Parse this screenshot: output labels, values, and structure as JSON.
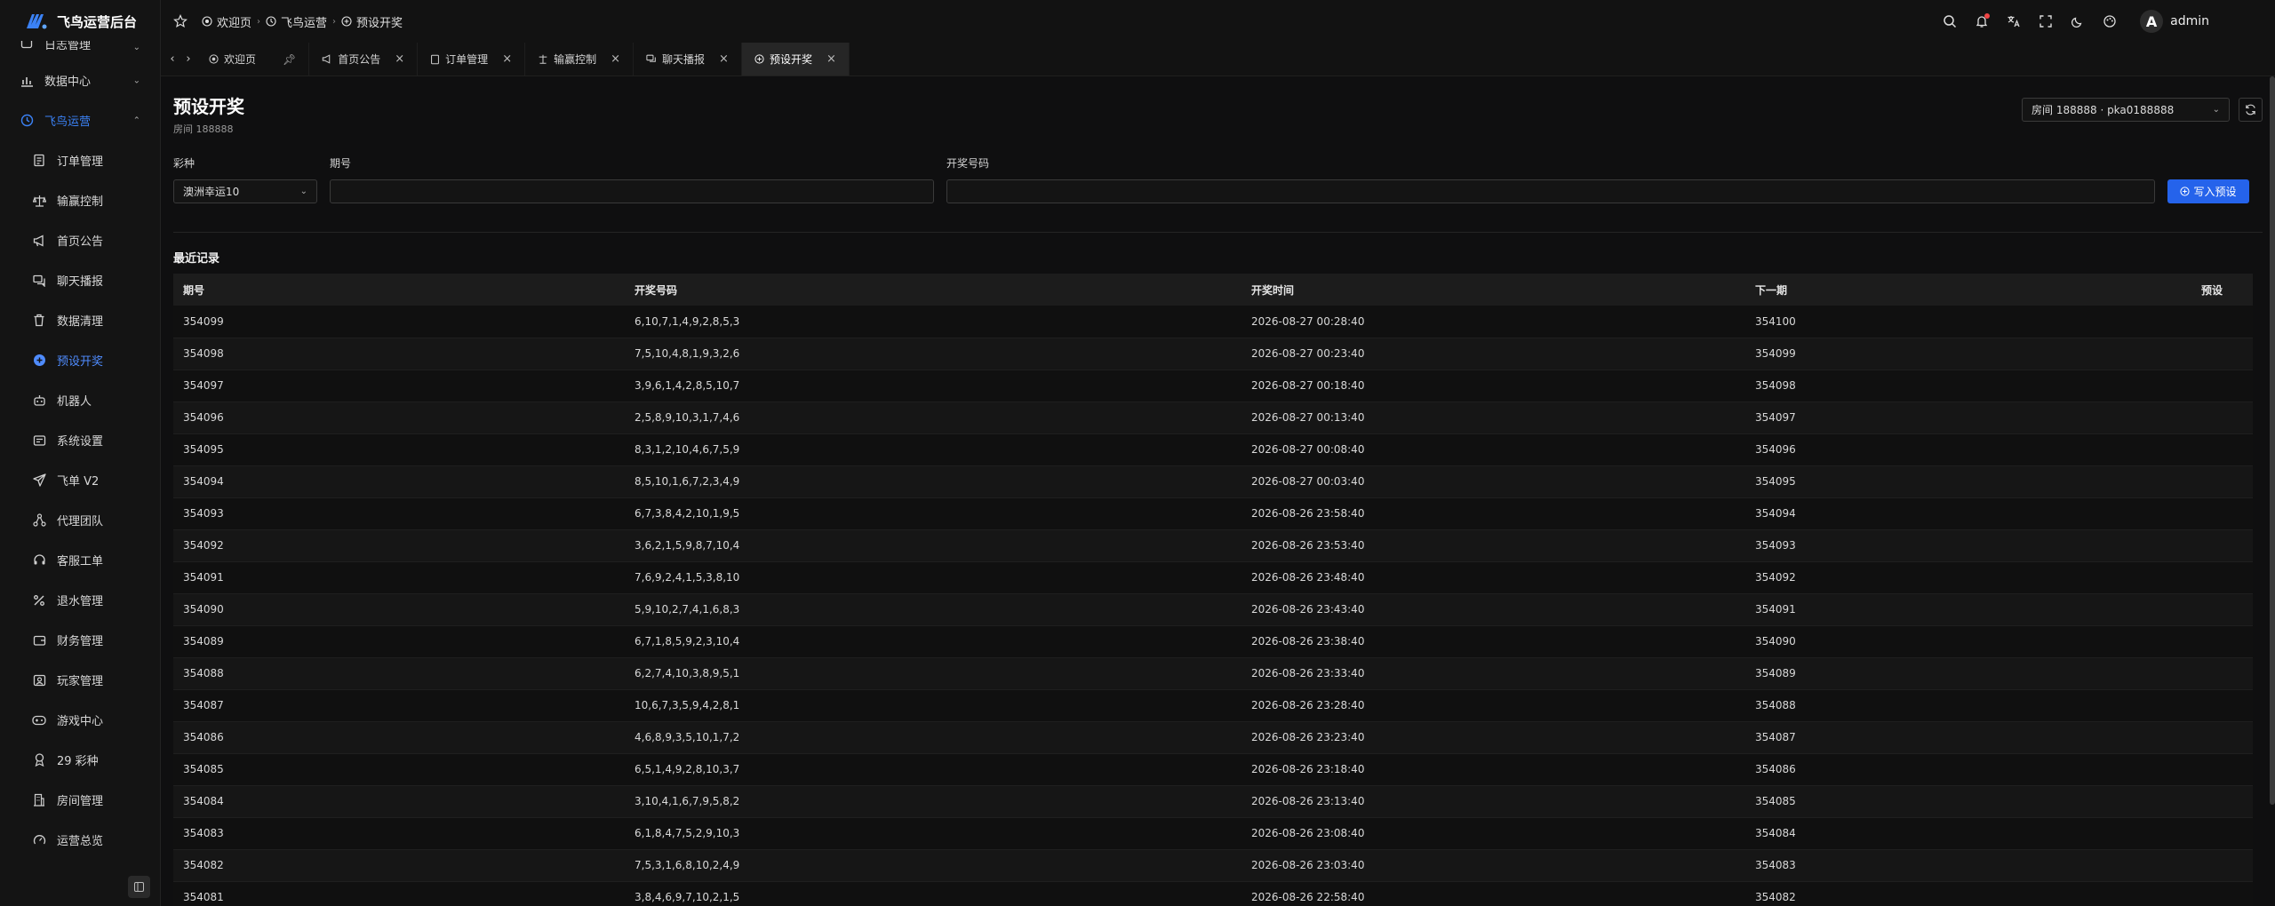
{
  "app": {
    "title": "飞鸟运营后台"
  },
  "sidebar": {
    "items": [
      {
        "label": "日志管理",
        "icon": "log-icon",
        "chev": "⌄"
      },
      {
        "label": "数据中心",
        "icon": "chart-icon",
        "chev": "⌄"
      },
      {
        "label": "飞鸟运营",
        "icon": "clock-icon",
        "chev": "⌃"
      },
      {
        "label": "订单管理",
        "icon": "order-icon"
      },
      {
        "label": "输赢控制",
        "icon": "scale-icon"
      },
      {
        "label": "首页公告",
        "icon": "megaphone-icon"
      },
      {
        "label": "聊天播报",
        "icon": "chat-icon"
      },
      {
        "label": "数据清理",
        "icon": "trash-icon"
      },
      {
        "label": "预设开奖",
        "icon": "plus-circle-icon"
      },
      {
        "label": "机器人",
        "icon": "robot-icon"
      },
      {
        "label": "系统设置",
        "icon": "settings-icon"
      },
      {
        "label": "飞单 V2",
        "icon": "plane-icon"
      },
      {
        "label": "代理团队",
        "icon": "team-icon"
      },
      {
        "label": "客服工单",
        "icon": "headset-icon"
      },
      {
        "label": "退水管理",
        "icon": "percent-icon"
      },
      {
        "label": "财务管理",
        "icon": "wallet-icon"
      },
      {
        "label": "玩家管理",
        "icon": "users-icon"
      },
      {
        "label": "游戏中心",
        "icon": "gamepad-icon"
      },
      {
        "label": "29 彩种",
        "icon": "lottery-icon"
      },
      {
        "label": "房间管理",
        "icon": "building-icon"
      },
      {
        "label": "运营总览",
        "icon": "gauge-icon"
      }
    ]
  },
  "header": {
    "breadcrumb": [
      "欢迎页",
      "飞鸟运营",
      "预设开奖"
    ],
    "user": "admin",
    "avatar_letter": "A"
  },
  "tabs": [
    {
      "label": "欢迎页",
      "closable": false
    },
    {
      "label": "首页公告",
      "closable": true
    },
    {
      "label": "订单管理",
      "closable": true
    },
    {
      "label": "输赢控制",
      "closable": true
    },
    {
      "label": "聊天播报",
      "closable": true
    },
    {
      "label": "预设开奖",
      "closable": true
    }
  ],
  "page": {
    "title": "预设开奖",
    "subtitle": "房间 188888",
    "room_select": "房间 188888 · pka0188888"
  },
  "form": {
    "lottery_label": "彩种",
    "lottery_value": "澳洲幸运10",
    "issue_label": "期号",
    "issue_value": "",
    "numbers_label": "开奖号码",
    "numbers_value": "",
    "submit_label": "写入预设"
  },
  "records": {
    "title": "最近记录",
    "columns": [
      "期号",
      "开奖号码",
      "开奖时间",
      "下一期",
      "预设"
    ],
    "rows": [
      [
        "354099",
        "6,10,7,1,4,9,2,8,5,3",
        "2026-08-27 00:28:40",
        "354100",
        ""
      ],
      [
        "354098",
        "7,5,10,4,8,1,9,3,2,6",
        "2026-08-27 00:23:40",
        "354099",
        ""
      ],
      [
        "354097",
        "3,9,6,1,4,2,8,5,10,7",
        "2026-08-27 00:18:40",
        "354098",
        ""
      ],
      [
        "354096",
        "2,5,8,9,10,3,1,7,4,6",
        "2026-08-27 00:13:40",
        "354097",
        ""
      ],
      [
        "354095",
        "8,3,1,2,10,4,6,7,5,9",
        "2026-08-27 00:08:40",
        "354096",
        ""
      ],
      [
        "354094",
        "8,5,10,1,6,7,2,3,4,9",
        "2026-08-27 00:03:40",
        "354095",
        ""
      ],
      [
        "354093",
        "6,7,3,8,4,2,10,1,9,5",
        "2026-08-26 23:58:40",
        "354094",
        ""
      ],
      [
        "354092",
        "3,6,2,1,5,9,8,7,10,4",
        "2026-08-26 23:53:40",
        "354093",
        ""
      ],
      [
        "354091",
        "7,6,9,2,4,1,5,3,8,10",
        "2026-08-26 23:48:40",
        "354092",
        ""
      ],
      [
        "354090",
        "5,9,10,2,7,4,1,6,8,3",
        "2026-08-26 23:43:40",
        "354091",
        ""
      ],
      [
        "354089",
        "6,7,1,8,5,9,2,3,10,4",
        "2026-08-26 23:38:40",
        "354090",
        ""
      ],
      [
        "354088",
        "6,2,7,4,10,3,8,9,5,1",
        "2026-08-26 23:33:40",
        "354089",
        ""
      ],
      [
        "354087",
        "10,6,7,3,5,9,4,2,8,1",
        "2026-08-26 23:28:40",
        "354088",
        ""
      ],
      [
        "354086",
        "4,6,8,9,3,5,10,1,7,2",
        "2026-08-26 23:23:40",
        "354087",
        ""
      ],
      [
        "354085",
        "6,5,1,4,9,2,8,10,3,7",
        "2026-08-26 23:18:40",
        "354086",
        ""
      ],
      [
        "354084",
        "3,10,4,1,6,7,9,5,8,2",
        "2026-08-26 23:13:40",
        "354085",
        ""
      ],
      [
        "354083",
        "6,1,8,4,7,5,2,9,10,3",
        "2026-08-26 23:08:40",
        "354084",
        ""
      ],
      [
        "354082",
        "7,5,3,1,6,8,10,2,4,9",
        "2026-08-26 23:03:40",
        "354083",
        ""
      ],
      [
        "354081",
        "3,8,4,6,9,7,10,2,1,5",
        "2026-08-26 22:58:40",
        "354082",
        ""
      ]
    ]
  },
  "colors": {
    "accent": "#2563eb",
    "active_nav": "#4f8cff",
    "background": "#0f0f10"
  }
}
